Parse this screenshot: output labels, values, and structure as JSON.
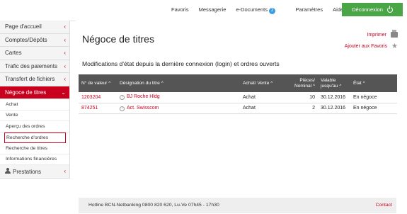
{
  "topnav": {
    "favoris": "Favoris",
    "messagerie": "Messagerie",
    "edocuments": "e-Documents",
    "edocuments_badge": "2",
    "parametres": "Paramètres",
    "aide": "Aide",
    "logout": "Déconnexion"
  },
  "sidebar": {
    "items": [
      {
        "label": "Page d'accueil"
      },
      {
        "label": "Comptes/Dépôts"
      },
      {
        "label": "Cartes"
      },
      {
        "label": "Trafic des paiements"
      },
      {
        "label": "Transfert de fichiers"
      },
      {
        "label": "Négoce de titres"
      }
    ],
    "sub": [
      {
        "label": "Achat"
      },
      {
        "label": "Vente"
      },
      {
        "label": "Aperçu des ordres"
      },
      {
        "label": "Recherche d'ordres"
      },
      {
        "label": "Recherche de titres"
      },
      {
        "label": "Informations financières"
      }
    ],
    "prestations": "Prestations"
  },
  "main": {
    "title": "Négoce de titres",
    "print": "Imprimer",
    "add_fav": "Ajouter aux Favoris",
    "subtitle": "Modifications d'état depuis la dernière connexion (login) et ordres ouverts"
  },
  "table": {
    "headers": {
      "no_valeur": "N° de valeur",
      "designation": "Désignation du titre",
      "achat_vente": "Achat/ Vente",
      "pieces": "Pièces/ Nominal",
      "valable": "Valable jusqu'au",
      "etat": "État"
    },
    "rows": [
      {
        "no": "1203204",
        "designation": "BJ Roche Hldg",
        "av": "Achat",
        "pieces": "10",
        "valable": "30.12.2016",
        "etat": "En négoce"
      },
      {
        "no": "874251",
        "designation": "Act. Swisscom",
        "av": "Achat",
        "pieces": "2",
        "valable": "30.12.2016",
        "etat": "En négoce"
      }
    ]
  },
  "footer": {
    "hotline": "Hotline BCN-Netbanking 0800 820 620, Lu-Ve 07h45 - 17h30",
    "contact": "Contact"
  },
  "colors": {
    "accent": "#c8001e",
    "logout": "#4aa547",
    "header": "#555555"
  }
}
